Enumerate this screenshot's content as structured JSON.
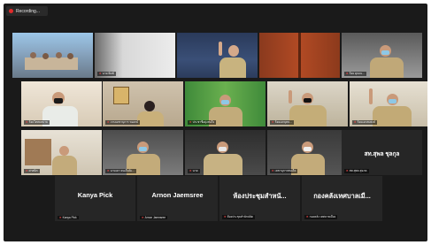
{
  "recording_label": "Recording...",
  "tiles": [
    {
      "caption": "",
      "name": ""
    },
    {
      "caption": "นาย พิมพ์",
      "name": ""
    },
    {
      "caption": "",
      "name": ""
    },
    {
      "caption": "",
      "name": ""
    },
    {
      "caption": "ร้อย คุณณ...",
      "name": ""
    },
    {
      "caption": "ร้อยโทสมหมาย",
      "name": ""
    },
    {
      "caption": "เกรงเลขานุการ ของกม์",
      "name": ""
    },
    {
      "caption": "ประชาชื่อยุ่งสนใจ",
      "name": ""
    },
    {
      "caption": "ร้อยเอกยุทธ...",
      "name": ""
    },
    {
      "caption": "ร้อยเอกสมพงษ์",
      "name": ""
    },
    {
      "caption": "ศาสนิก",
      "name": ""
    },
    {
      "caption": "นามเยา จนเด็นนิเ...",
      "name": ""
    },
    {
      "caption": "นาย",
      "name": ""
    },
    {
      "caption": "เลขานุการสมเด็จ",
      "name": ""
    },
    {
      "caption": "สท.สุพล สุฉกล",
      "name": "สท.สุพล ชุลกุล"
    },
    {
      "caption": "Kanya Pick",
      "name": "Kanya Pick"
    },
    {
      "caption": "Arnon Jaemsree",
      "name": "Arnon Jaemsree"
    },
    {
      "caption": "ห้องประชุมสำนักปลัด",
      "name": "ห้องประชุมสำหนั..."
    },
    {
      "caption": "กองคลัง เทศบาลเมือง",
      "name": "กองคลังเทศบาลเมื..."
    }
  ]
}
